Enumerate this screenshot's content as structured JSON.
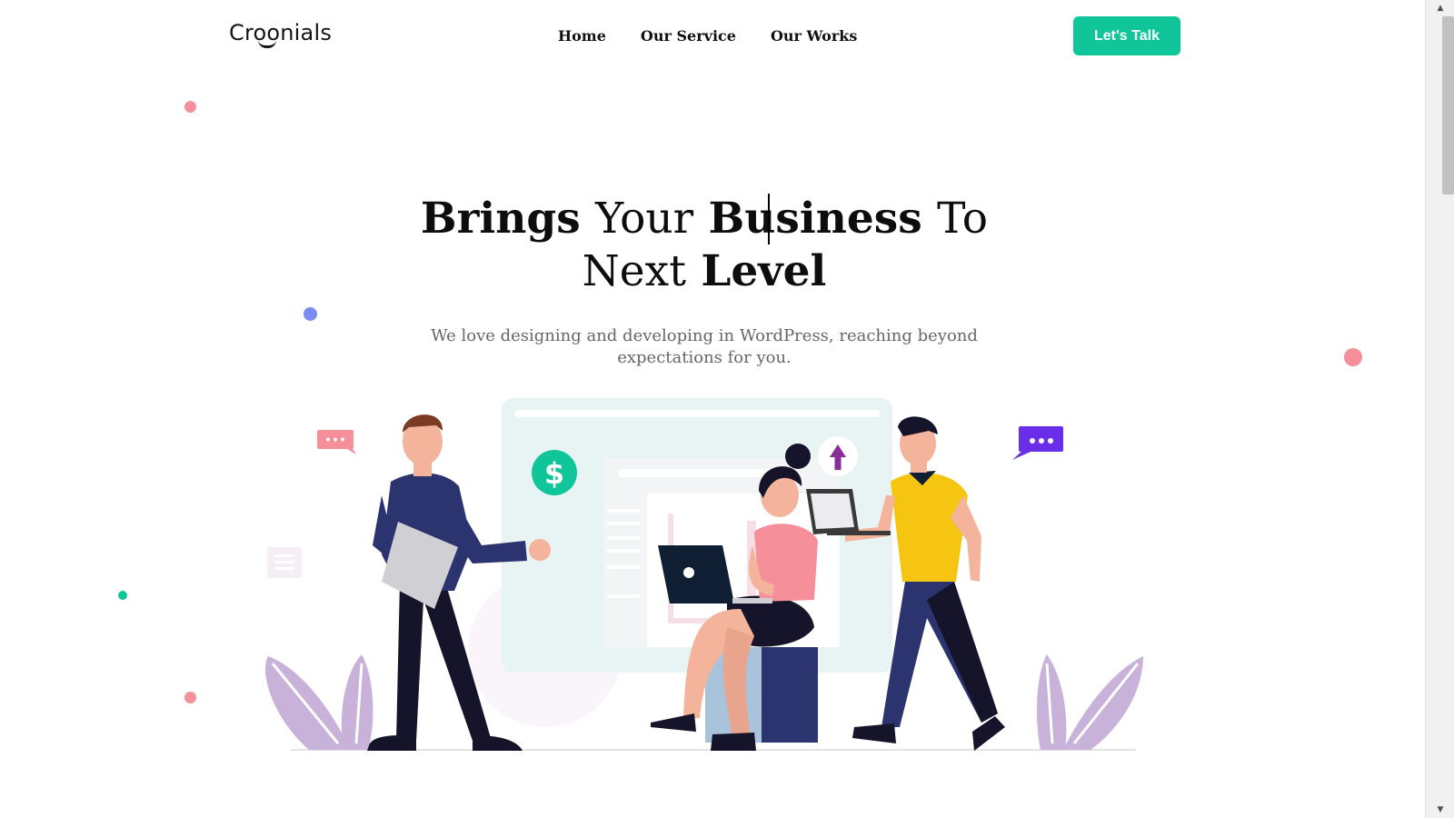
{
  "header": {
    "logo_text": "Croonials",
    "nav": [
      {
        "label": "Home"
      },
      {
        "label": "Our Service"
      },
      {
        "label": "Our Works"
      }
    ],
    "cta_label": "Let's Talk"
  },
  "hero": {
    "title_parts": [
      {
        "text": "Brings",
        "weight": "bold"
      },
      {
        "text": "Your",
        "weight": "light"
      },
      {
        "text": "Business",
        "weight": "bold"
      },
      {
        "text": "To",
        "weight": "light"
      },
      {
        "text": "Next",
        "weight": "light"
      },
      {
        "text": "Level",
        "weight": "bold"
      }
    ],
    "subtitle": "We love designing and developing in WordPress, reaching beyond expectations for you."
  },
  "illustration": {
    "dollar_symbol": "$",
    "icons": [
      "dollar-coin-icon",
      "upload-arrow-icon",
      "chat-bubble-icon",
      "document-icon",
      "laptop-icon",
      "leaf-plant-icon"
    ]
  },
  "colors": {
    "accent": "#10c59a",
    "pink": "#f58f9a",
    "blue_dot": "#7a8cf0",
    "purple_bubble": "#6a2ee8",
    "navy": "#2c3470",
    "yellow_shirt": "#f5c512",
    "leaf": "#c9b2d9"
  }
}
